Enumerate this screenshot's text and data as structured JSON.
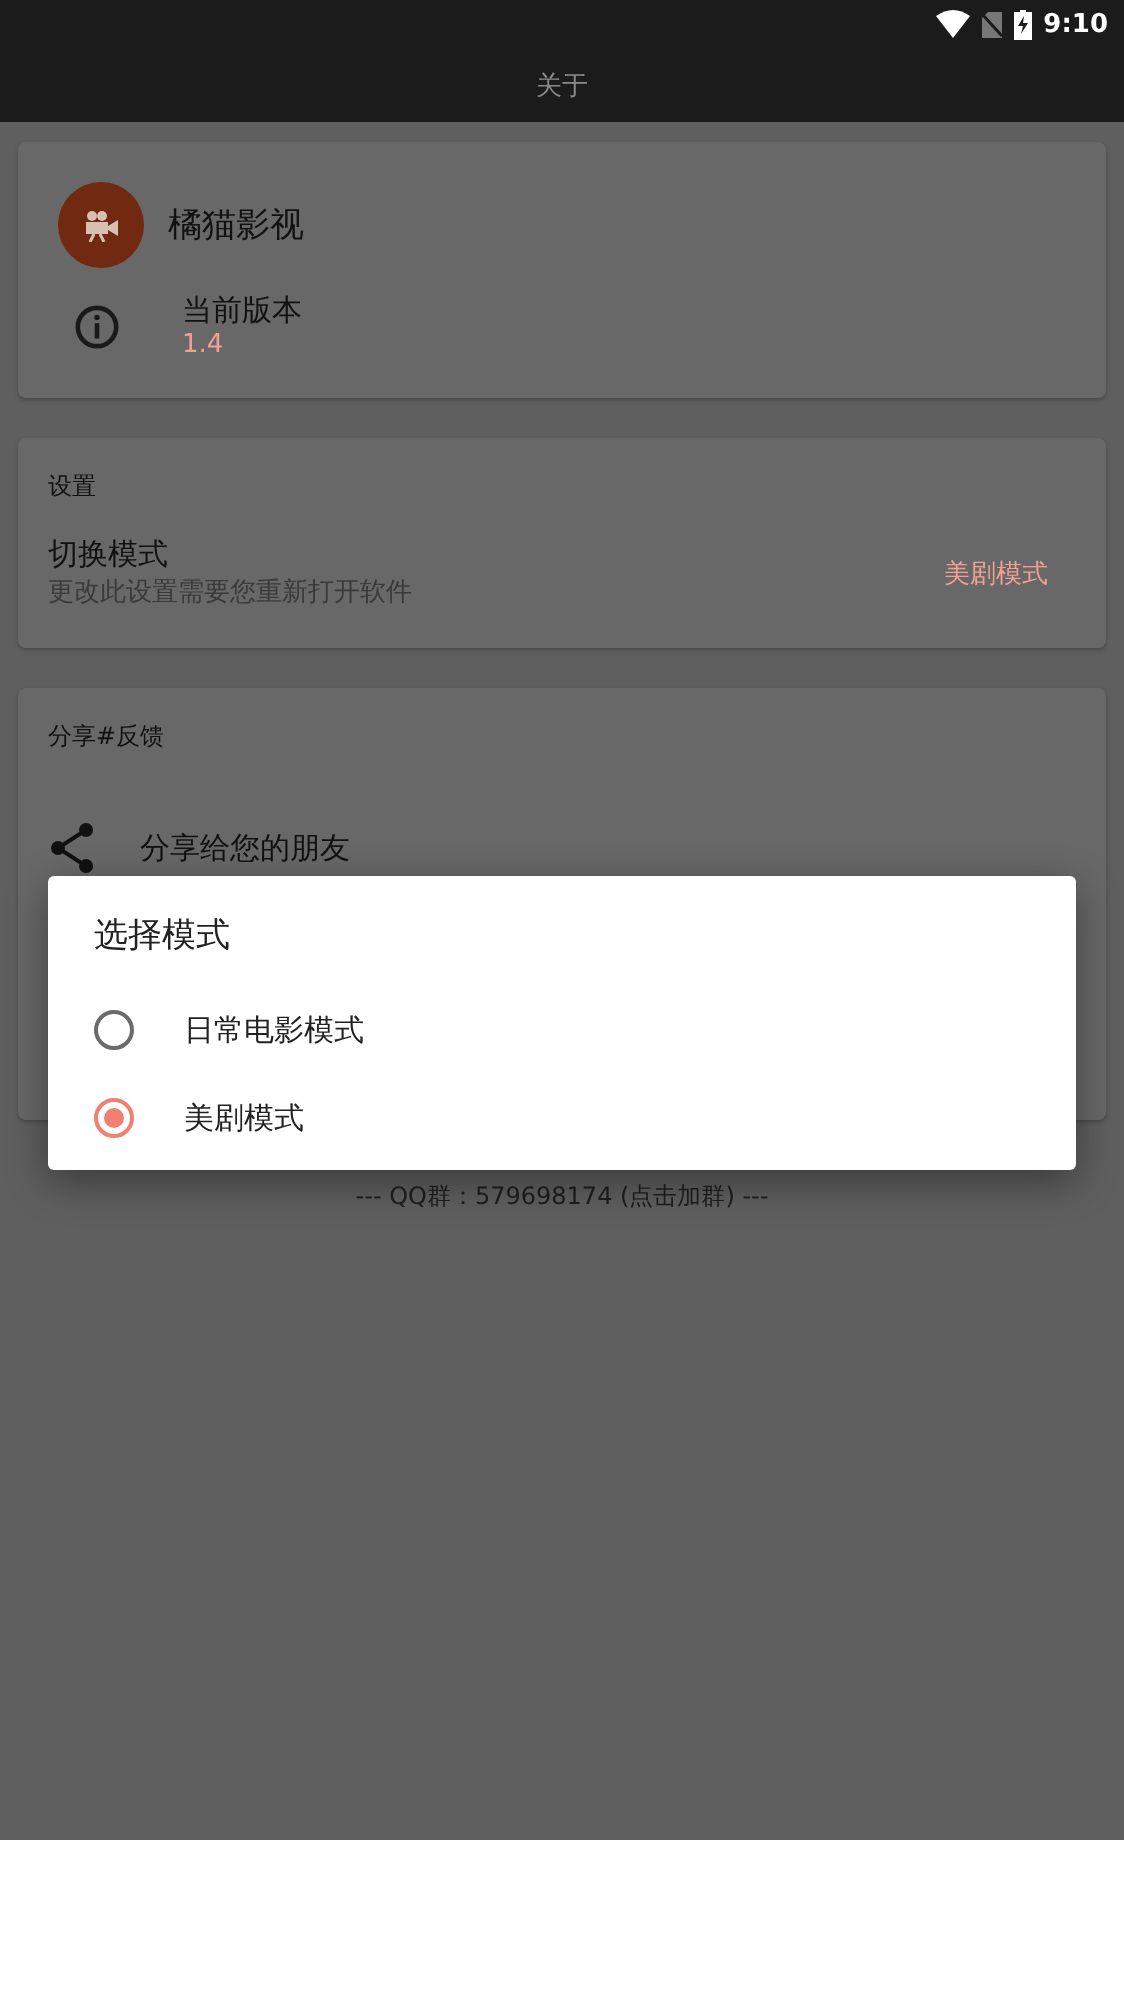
{
  "status_bar": {
    "time": "9:10"
  },
  "app_bar": {
    "title": "关于"
  },
  "about_card": {
    "app_name": "橘猫影视",
    "version_label": "当前版本",
    "version": "1.4"
  },
  "settings_card": {
    "heading": "设置",
    "item": {
      "title": "切换模式",
      "subtitle": "更改此设置需要您重新打开软件",
      "value": "美剧模式"
    }
  },
  "share_card": {
    "heading": "分享#反馈",
    "item": {
      "title": "分享给您的朋友"
    }
  },
  "footer": {
    "text": "--- QQ群：579698174 (点击加群) ---"
  },
  "dialog": {
    "title": "选择模式",
    "options": [
      {
        "label": "日常电影模式",
        "selected": false
      },
      {
        "label": "美剧模式",
        "selected": true
      }
    ]
  }
}
